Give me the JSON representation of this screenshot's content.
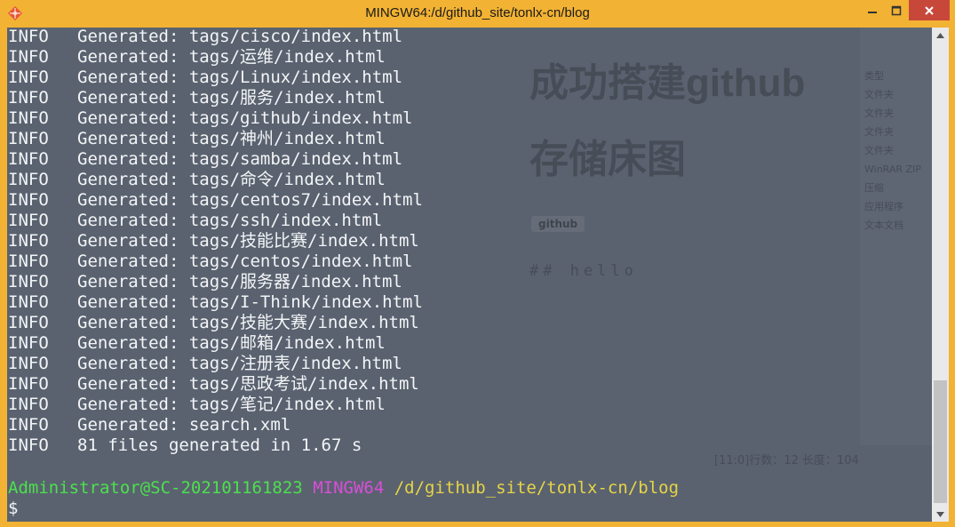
{
  "window": {
    "title": "MINGW64:/d/github_site/tonlx-cn/blog",
    "icon": "git-bash-icon"
  },
  "terminal": {
    "background": "#5a6270",
    "lines": [
      {
        "level": "INFO",
        "message": "Generated: tags/cisco/index.html"
      },
      {
        "level": "INFO",
        "message": "Generated: tags/运维/index.html"
      },
      {
        "level": "INFO",
        "message": "Generated: tags/Linux/index.html"
      },
      {
        "level": "INFO",
        "message": "Generated: tags/服务/index.html"
      },
      {
        "level": "INFO",
        "message": "Generated: tags/github/index.html"
      },
      {
        "level": "INFO",
        "message": "Generated: tags/神州/index.html"
      },
      {
        "level": "INFO",
        "message": "Generated: tags/samba/index.html"
      },
      {
        "level": "INFO",
        "message": "Generated: tags/命令/index.html"
      },
      {
        "level": "INFO",
        "message": "Generated: tags/centos7/index.html"
      },
      {
        "level": "INFO",
        "message": "Generated: tags/ssh/index.html"
      },
      {
        "level": "INFO",
        "message": "Generated: tags/技能比赛/index.html"
      },
      {
        "level": "INFO",
        "message": "Generated: tags/centos/index.html"
      },
      {
        "level": "INFO",
        "message": "Generated: tags/服务器/index.html"
      },
      {
        "level": "INFO",
        "message": "Generated: tags/I-Think/index.html"
      },
      {
        "level": "INFO",
        "message": "Generated: tags/技能大赛/index.html"
      },
      {
        "level": "INFO",
        "message": "Generated: tags/邮箱/index.html"
      },
      {
        "level": "INFO",
        "message": "Generated: tags/注册表/index.html"
      },
      {
        "level": "INFO",
        "message": "Generated: tags/思政考试/index.html"
      },
      {
        "level": "INFO",
        "message": "Generated: tags/笔记/index.html"
      },
      {
        "level": "INFO",
        "message": "Generated: search.xml"
      },
      {
        "level": "INFO",
        "message": "81 files generated in 1.67 s"
      }
    ],
    "prompt": {
      "user_host": "Administrator@SC-202101161823",
      "system": "MINGW64",
      "path": "/d/github_site/tonlx-cn/blog",
      "symbol": "$"
    },
    "colors": {
      "text": "#f3f5f6",
      "user": "#4ce04c",
      "system": "#d84ed6",
      "path": "#e6d445"
    }
  },
  "background_window": {
    "heading_line1": "成功搭建github",
    "heading_line2": "存储床图",
    "tag": "github",
    "body": "## hello",
    "status": "[11:0]行数：12  长度：104",
    "sidebar_header": "类型",
    "sidebar_items": [
      "文件夹",
      "文件夹",
      "文件夹",
      "文件夹",
      "WinRAR ZIP 压缩",
      "应用程序",
      "文本文档"
    ]
  }
}
